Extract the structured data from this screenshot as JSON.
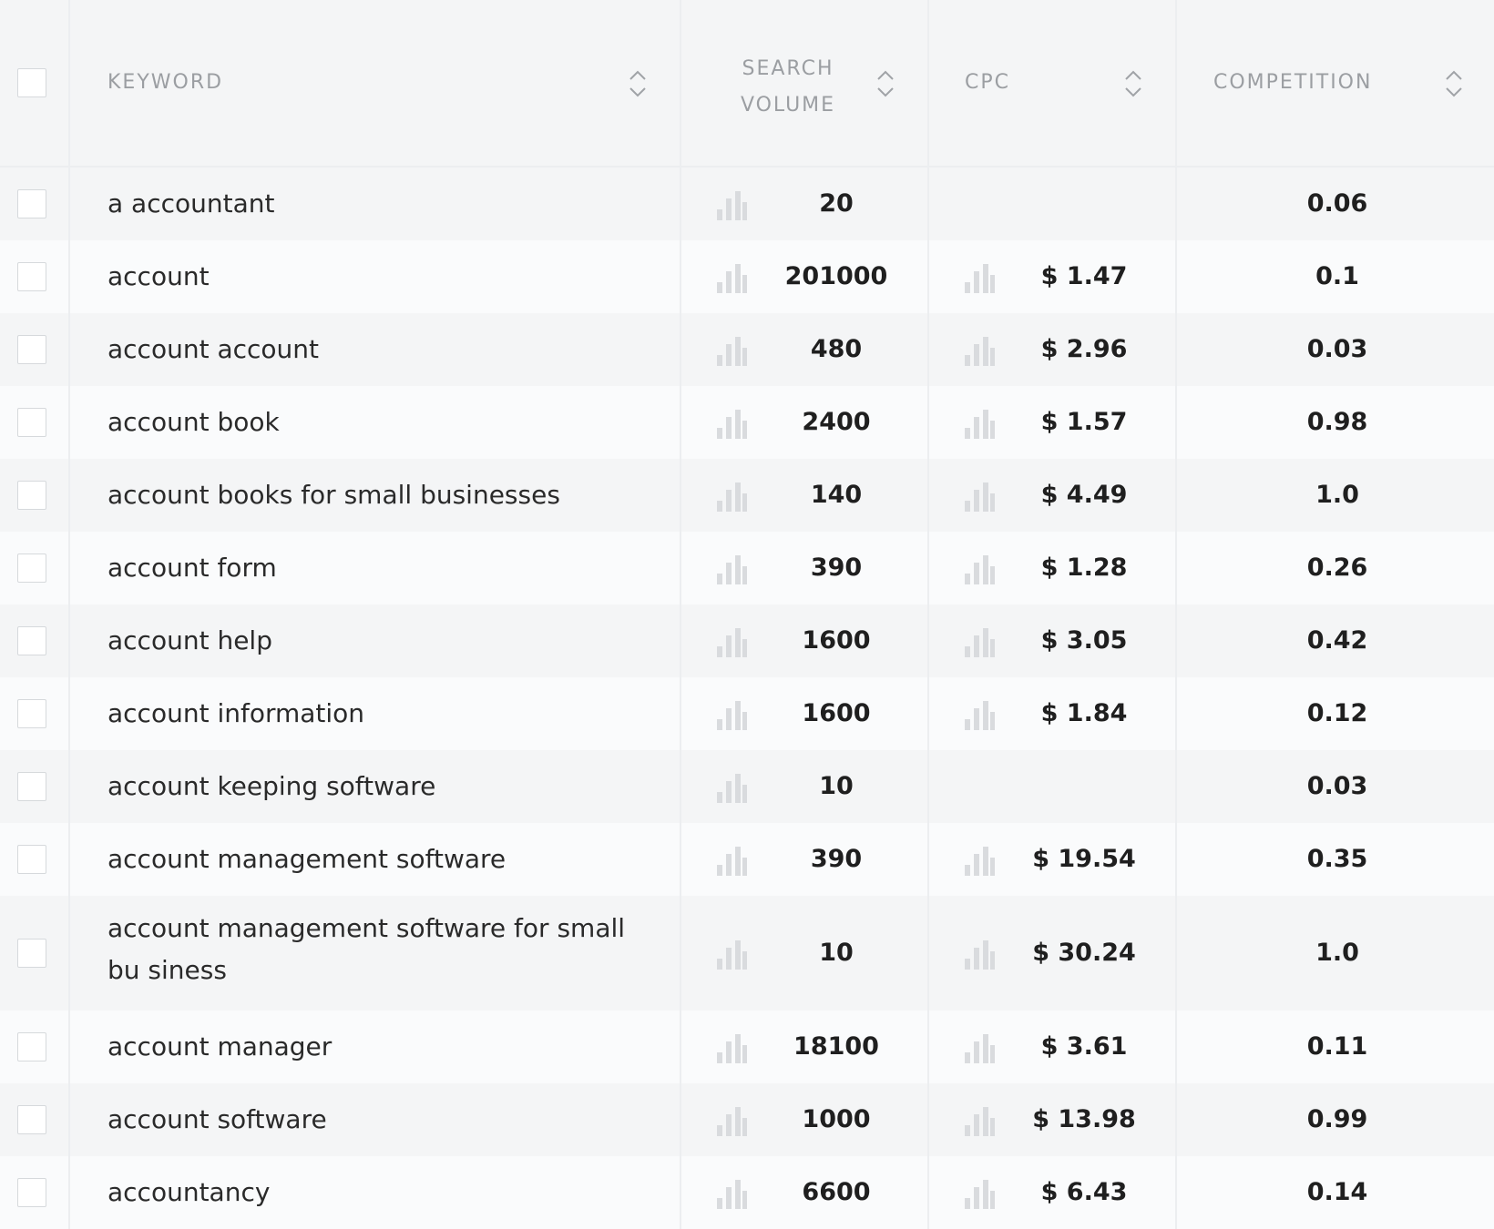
{
  "header": {
    "keyword": "KEYWORD",
    "search_volume": "SEARCH VOLUME",
    "cpc": "CPC",
    "competition": "COMPETITION"
  },
  "rows": [
    {
      "keyword": "a accountant",
      "volume": "20",
      "cpc": "",
      "competition": "0.06"
    },
    {
      "keyword": "account",
      "volume": "201000",
      "cpc": "$ 1.47",
      "competition": "0.1"
    },
    {
      "keyword": "account account",
      "volume": "480",
      "cpc": "$ 2.96",
      "competition": "0.03"
    },
    {
      "keyword": "account book",
      "volume": "2400",
      "cpc": "$ 1.57",
      "competition": "0.98"
    },
    {
      "keyword": "account books for small businesses",
      "volume": "140",
      "cpc": "$ 4.49",
      "competition": "1.0"
    },
    {
      "keyword": "account form",
      "volume": "390",
      "cpc": "$ 1.28",
      "competition": "0.26"
    },
    {
      "keyword": "account help",
      "volume": "1600",
      "cpc": "$ 3.05",
      "competition": "0.42"
    },
    {
      "keyword": "account information",
      "volume": "1600",
      "cpc": "$ 1.84",
      "competition": "0.12"
    },
    {
      "keyword": "account keeping software",
      "volume": "10",
      "cpc": "",
      "competition": "0.03"
    },
    {
      "keyword": "account management software",
      "volume": "390",
      "cpc": "$ 19.54",
      "competition": "0.35"
    },
    {
      "keyword": "account management software for small bu siness",
      "volume": "10",
      "cpc": "$ 30.24",
      "competition": "1.0"
    },
    {
      "keyword": "account manager",
      "volume": "18100",
      "cpc": "$ 3.61",
      "competition": "0.11"
    },
    {
      "keyword": "account software",
      "volume": "1000",
      "cpc": "$ 13.98",
      "competition": "0.99"
    },
    {
      "keyword": "accountancy",
      "volume": "6600",
      "cpc": "$ 6.43",
      "competition": "0.14"
    }
  ],
  "icons": {
    "sort": "sort-arrows-icon",
    "trend": "bar-chart-icon",
    "checkbox": "checkbox"
  },
  "colors": {
    "header_bg": "#f4f5f6",
    "row_odd": "#f4f5f6",
    "row_even": "#fafbfc",
    "header_text": "#9b9ea2",
    "icon": "#d9dbde"
  }
}
